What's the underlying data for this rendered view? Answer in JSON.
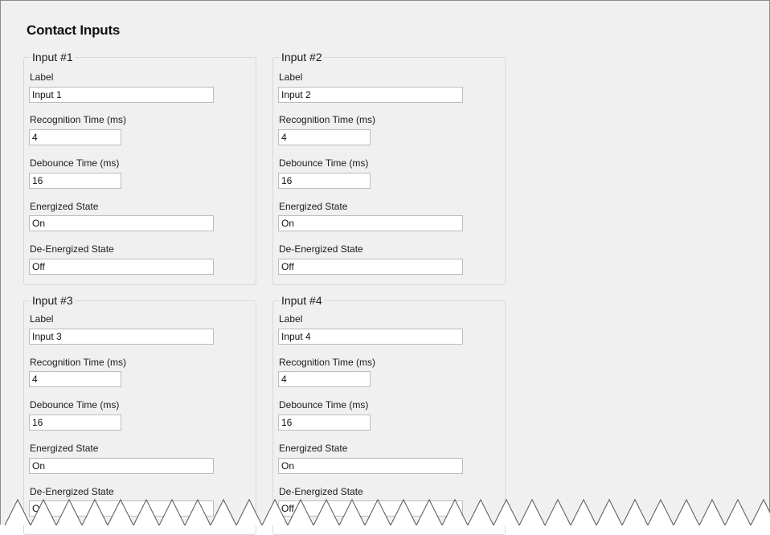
{
  "section_title": "Contact Inputs",
  "field_labels": {
    "label": "Label",
    "recognition_time": "Recognition Time (ms)",
    "debounce_time": "Debounce Time (ms)",
    "energized_state": "Energized State",
    "de_energized_state": "De-Energized State"
  },
  "inputs": [
    {
      "title": "Input #1",
      "label": "Input 1",
      "recognition_time": "4",
      "debounce_time": "16",
      "energized_state": "On",
      "de_energized_state": "Off"
    },
    {
      "title": "Input #2",
      "label": "Input 2",
      "recognition_time": "4",
      "debounce_time": "16",
      "energized_state": "On",
      "de_energized_state": "Off"
    },
    {
      "title": "Input #3",
      "label": "Input 3",
      "recognition_time": "4",
      "debounce_time": "16",
      "energized_state": "On",
      "de_energized_state": "Off"
    },
    {
      "title": "Input #4",
      "label": "Input 4",
      "recognition_time": "4",
      "debounce_time": "16",
      "energized_state": "On",
      "de_energized_state": "Off"
    }
  ]
}
